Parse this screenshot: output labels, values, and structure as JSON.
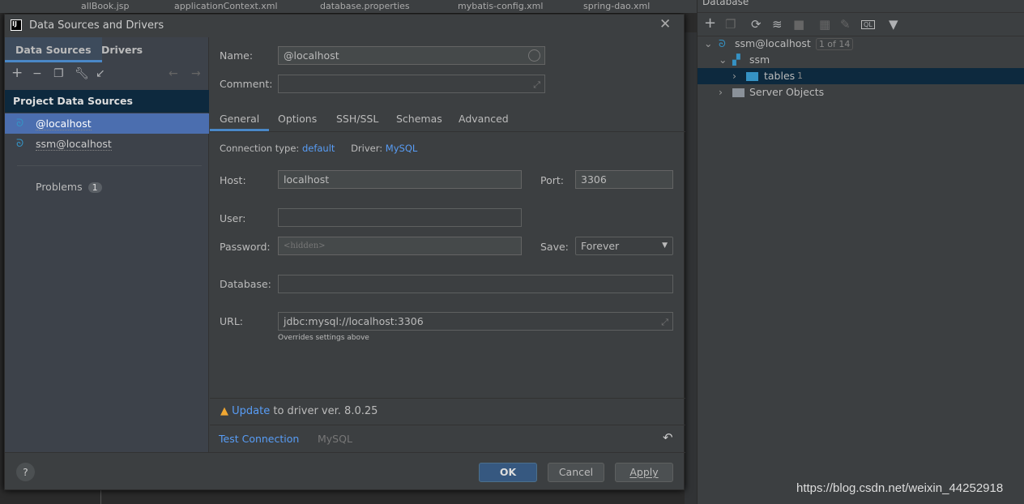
{
  "ide": {
    "editor_tabs": [
      "allBook.jsp",
      "applicationContext.xml",
      "database.properties",
      "mybatis-config.xml",
      "spring-dao.xml"
    ],
    "watermark": "https://blog.csdn.net/weixin_44252918"
  },
  "database_panel": {
    "title": "Database",
    "toolbar": [
      "add-icon",
      "duplicate-icon",
      "refresh-icon",
      "schema-settings-icon",
      "stop-icon",
      "table-icon",
      "edit-icon",
      "sql-console-icon",
      "filter-icon"
    ],
    "tree": [
      {
        "label": "ssm@localhost",
        "badge": "1 of 14",
        "expanded": true
      },
      {
        "label": "ssm",
        "expanded": true
      },
      {
        "label": "tables",
        "count": "1",
        "selected": true
      },
      {
        "label": "Server Objects",
        "expanded": false
      }
    ]
  },
  "dialog": {
    "title": "Data Sources and Drivers",
    "left_tabs": [
      "Data Sources",
      "Drivers"
    ],
    "section_header": "Project Data Sources",
    "data_sources": [
      {
        "label": "@localhost",
        "selected": true
      },
      {
        "label": "ssm@localhost",
        "selected": false
      }
    ],
    "problems": {
      "label": "Problems",
      "count": "1"
    },
    "name_label": "Name:",
    "name_value": "@localhost",
    "comment_label": "Comment:",
    "comment_value": "",
    "tabs": [
      "General",
      "Options",
      "SSH/SSL",
      "Schemas",
      "Advanced"
    ],
    "active_tab": "General",
    "connection_type_label": "Connection type:",
    "connection_type": "default",
    "driver_label": "Driver:",
    "driver": "MySQL",
    "host_label": "Host:",
    "host": "localhost",
    "port_label": "Port:",
    "port": "3306",
    "user_label": "User:",
    "user": "",
    "password_label": "Password:",
    "password_placeholder": "<hidden>",
    "save_label": "Save:",
    "save_value": "Forever",
    "database_label": "Database:",
    "database": "",
    "url_label": "URL:",
    "url": "jdbc:mysql://localhost:3306",
    "url_hint": "Overrides settings above",
    "update_link": "Update",
    "update_text": "to driver ver. 8.0.25",
    "test_connection": "Test Connection",
    "driver_name": "MySQL",
    "buttons": {
      "help": "?",
      "ok": "OK",
      "cancel": "Cancel",
      "apply": "Apply"
    },
    "accent": "#4a88c7",
    "link_color": "#589df6",
    "selection": "#4b6eaf"
  }
}
